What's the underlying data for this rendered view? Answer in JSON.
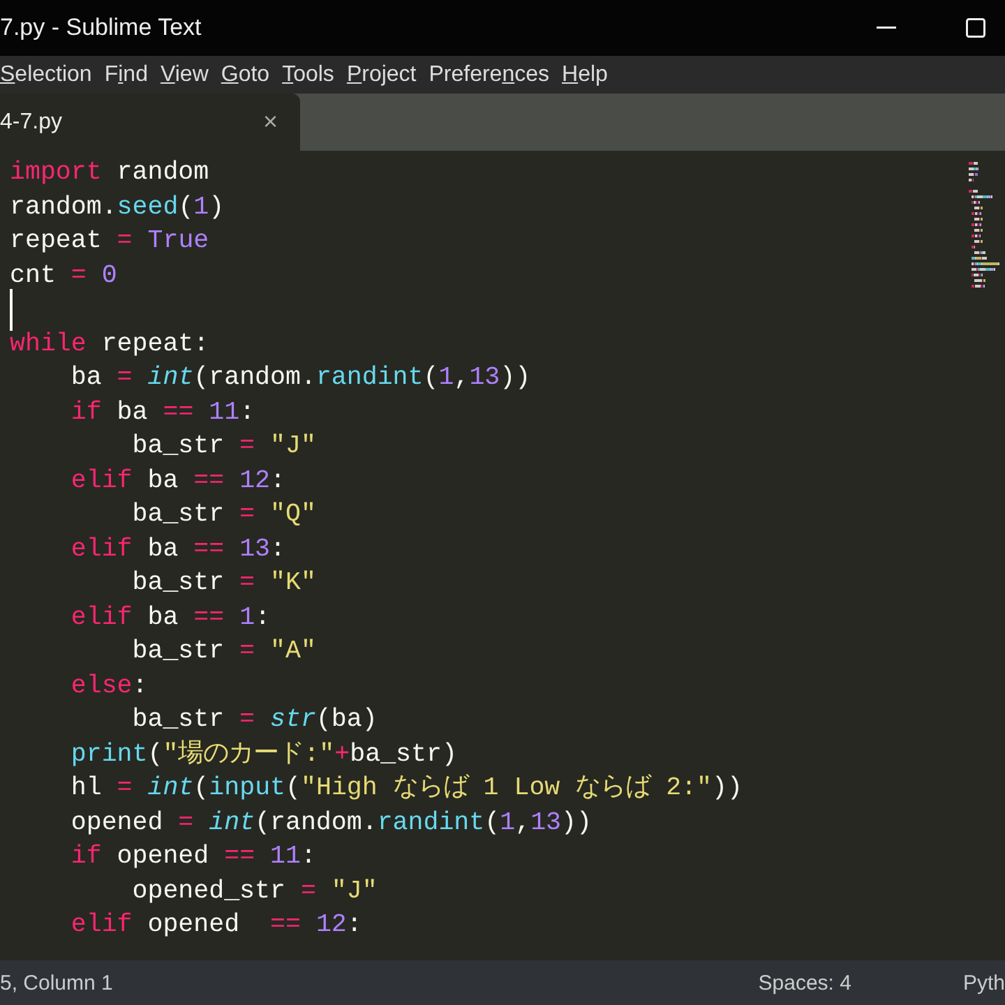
{
  "window": {
    "title": "7.py - Sublime Text"
  },
  "menu": [
    {
      "key": "S",
      "post": "election"
    },
    {
      "pre": "F",
      "key": "i",
      "post": "nd"
    },
    {
      "key": "V",
      "post": "iew"
    },
    {
      "key": "G",
      "post": "oto"
    },
    {
      "key": "T",
      "post": "ools"
    },
    {
      "key": "P",
      "post": "roject"
    },
    {
      "pre": "Prefere",
      "key": "n",
      "post": "ces"
    },
    {
      "key": "H",
      "post": "elp"
    }
  ],
  "tabs": [
    {
      "label": "4-7.py",
      "close": "×",
      "selected": true
    }
  ],
  "editor": {
    "lines": [
      {
        "tokens": [
          {
            "kind": "kw",
            "text": "import"
          },
          {
            "kind": "plain",
            "text": " random"
          }
        ]
      },
      {
        "tokens": [
          {
            "kind": "plain",
            "text": "random."
          },
          {
            "kind": "fn",
            "text": "seed"
          },
          {
            "kind": "plain",
            "text": "("
          },
          {
            "kind": "num",
            "text": "1"
          },
          {
            "kind": "plain",
            "text": ")"
          }
        ]
      },
      {
        "tokens": [
          {
            "kind": "plain",
            "text": "repeat "
          },
          {
            "kind": "op",
            "text": "="
          },
          {
            "kind": "num",
            "text": " True"
          }
        ]
      },
      {
        "tokens": [
          {
            "kind": "plain",
            "text": "cnt "
          },
          {
            "kind": "op",
            "text": "="
          },
          {
            "kind": "num",
            "text": " 0"
          }
        ]
      },
      {
        "cursor": true
      },
      {
        "tokens": [
          {
            "kind": "kw",
            "text": "while"
          },
          {
            "kind": "plain",
            "text": " repeat:"
          }
        ],
        "children": [
          {
            "tokens": [
              {
                "kind": "plain",
                "text": "ba "
              },
              {
                "kind": "op",
                "text": "= "
              },
              {
                "kind": "builtin",
                "text": "int"
              },
              {
                "kind": "plain",
                "text": "(random."
              },
              {
                "kind": "fn",
                "text": "randint"
              },
              {
                "kind": "plain",
                "text": "("
              },
              {
                "kind": "num",
                "text": "1"
              },
              {
                "kind": "plain",
                "text": ","
              },
              {
                "kind": "num",
                "text": "13"
              },
              {
                "kind": "plain",
                "text": "))"
              }
            ]
          },
          {
            "tokens": [
              {
                "kind": "kw",
                "text": "if"
              },
              {
                "kind": "plain",
                "text": " ba "
              },
              {
                "kind": "op",
                "text": "=="
              },
              {
                "kind": "num",
                "text": " 11"
              },
              {
                "kind": "plain",
                "text": ":"
              }
            ],
            "children": [
              {
                "tokens": [
                  {
                    "kind": "plain",
                    "text": "ba_str "
                  },
                  {
                    "kind": "op",
                    "text": "="
                  },
                  {
                    "kind": "str",
                    "text": " \"J\""
                  }
                ]
              }
            ]
          },
          {
            "tokens": [
              {
                "kind": "kw",
                "text": "elif"
              },
              {
                "kind": "plain",
                "text": " ba "
              },
              {
                "kind": "op",
                "text": "=="
              },
              {
                "kind": "num",
                "text": " 12"
              },
              {
                "kind": "plain",
                "text": ":"
              }
            ],
            "children": [
              {
                "tokens": [
                  {
                    "kind": "plain",
                    "text": "ba_str "
                  },
                  {
                    "kind": "op",
                    "text": "="
                  },
                  {
                    "kind": "str",
                    "text": " \"Q\""
                  }
                ]
              }
            ]
          },
          {
            "tokens": [
              {
                "kind": "kw",
                "text": "elif"
              },
              {
                "kind": "plain",
                "text": " ba "
              },
              {
                "kind": "op",
                "text": "=="
              },
              {
                "kind": "num",
                "text": " 13"
              },
              {
                "kind": "plain",
                "text": ":"
              }
            ],
            "children": [
              {
                "tokens": [
                  {
                    "kind": "plain",
                    "text": "ba_str "
                  },
                  {
                    "kind": "op",
                    "text": "="
                  },
                  {
                    "kind": "str",
                    "text": " \"K\""
                  }
                ]
              }
            ]
          },
          {
            "tokens": [
              {
                "kind": "kw",
                "text": "elif"
              },
              {
                "kind": "plain",
                "text": " ba "
              },
              {
                "kind": "op",
                "text": "=="
              },
              {
                "kind": "num",
                "text": " 1"
              },
              {
                "kind": "plain",
                "text": ":"
              }
            ],
            "children": [
              {
                "tokens": [
                  {
                    "kind": "plain",
                    "text": "ba_str "
                  },
                  {
                    "kind": "op",
                    "text": "="
                  },
                  {
                    "kind": "str",
                    "text": " \"A\""
                  }
                ]
              }
            ]
          },
          {
            "tokens": [
              {
                "kind": "kw",
                "text": "else"
              },
              {
                "kind": "plain",
                "text": ":"
              }
            ],
            "children": [
              {
                "tokens": [
                  {
                    "kind": "plain",
                    "text": "ba_str "
                  },
                  {
                    "kind": "op",
                    "text": "= "
                  },
                  {
                    "kind": "builtin",
                    "text": "str"
                  },
                  {
                    "kind": "plain",
                    "text": "(ba)"
                  }
                ]
              }
            ]
          },
          {
            "tokens": [
              {
                "kind": "fn",
                "text": "print"
              },
              {
                "kind": "plain",
                "text": "("
              },
              {
                "kind": "str",
                "text": "\"場のカード:\""
              },
              {
                "kind": "op",
                "text": "+"
              },
              {
                "kind": "plain",
                "text": "ba_str)"
              }
            ]
          },
          {
            "tokens": [
              {
                "kind": "plain",
                "text": "hl "
              },
              {
                "kind": "op",
                "text": "= "
              },
              {
                "kind": "builtin",
                "text": "int"
              },
              {
                "kind": "plain",
                "text": "("
              },
              {
                "kind": "fn",
                "text": "input"
              },
              {
                "kind": "plain",
                "text": "("
              },
              {
                "kind": "str",
                "text": "\"High ならば 1 Low ならば 2:\""
              },
              {
                "kind": "plain",
                "text": "))"
              }
            ]
          },
          {
            "tokens": [
              {
                "kind": "plain",
                "text": "opened "
              },
              {
                "kind": "op",
                "text": "= "
              },
              {
                "kind": "builtin",
                "text": "int"
              },
              {
                "kind": "plain",
                "text": "(random."
              },
              {
                "kind": "fn",
                "text": "randint"
              },
              {
                "kind": "plain",
                "text": "("
              },
              {
                "kind": "num",
                "text": "1"
              },
              {
                "kind": "plain",
                "text": ","
              },
              {
                "kind": "num",
                "text": "13"
              },
              {
                "kind": "plain",
                "text": "))"
              }
            ]
          },
          {
            "tokens": [
              {
                "kind": "kw",
                "text": "if"
              },
              {
                "kind": "plain",
                "text": " opened "
              },
              {
                "kind": "op",
                "text": "=="
              },
              {
                "kind": "num",
                "text": " 11"
              },
              {
                "kind": "plain",
                "text": ":"
              }
            ],
            "children": [
              {
                "tokens": [
                  {
                    "kind": "plain",
                    "text": "opened_str "
                  },
                  {
                    "kind": "op",
                    "text": "="
                  },
                  {
                    "kind": "str",
                    "text": " \"J\""
                  }
                ]
              }
            ]
          },
          {
            "tokens": [
              {
                "kind": "kw",
                "text": "elif"
              },
              {
                "kind": "plain",
                "text": " opened  "
              },
              {
                "kind": "op",
                "text": "=="
              },
              {
                "kind": "num",
                "text": " 12"
              },
              {
                "kind": "plain",
                "text": ":"
              }
            ]
          }
        ]
      }
    ]
  },
  "status_bar": {
    "position": "5, Column 1",
    "indentation": "Spaces: 4",
    "syntax": "Pyth"
  }
}
